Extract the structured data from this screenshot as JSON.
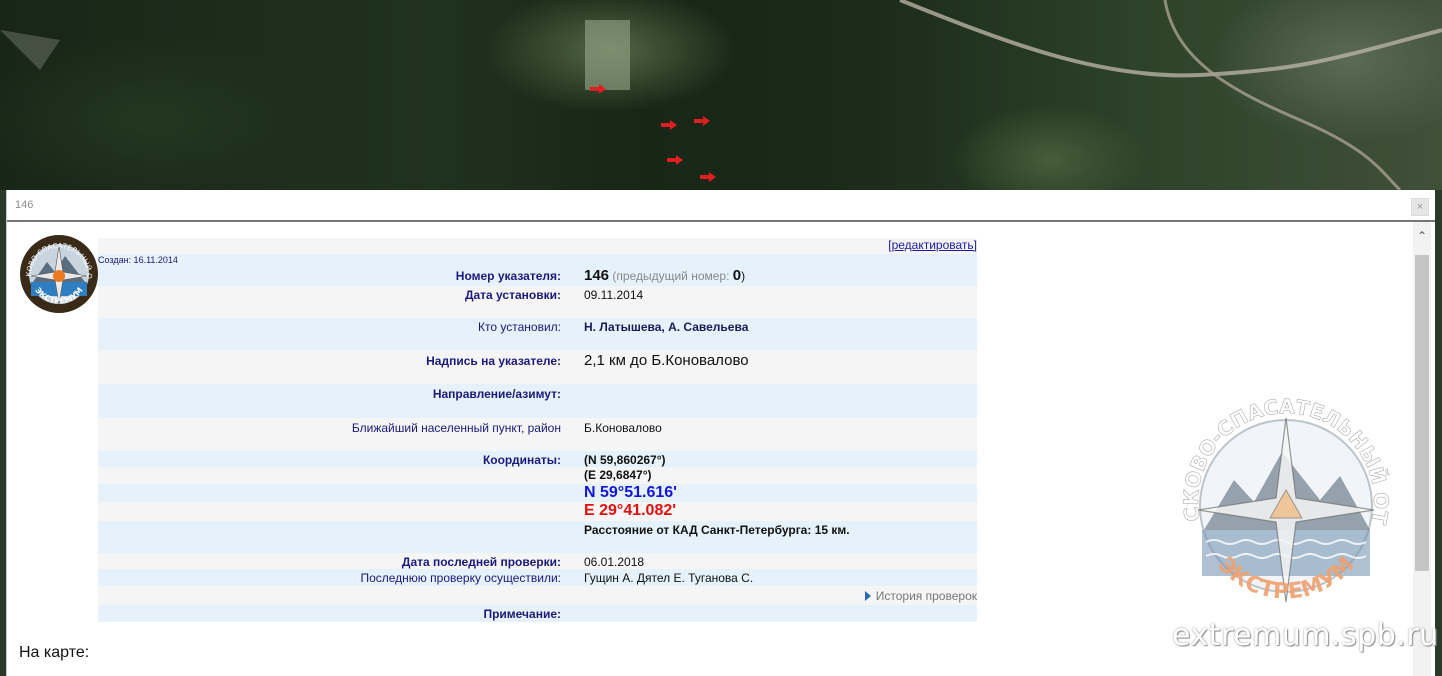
{
  "dialog": {
    "title": "146",
    "close_label": "×"
  },
  "card": {
    "edit_link": "[редактировать]",
    "created": "Создан: 16.11.2014",
    "pointer_number_label": "Номер указателя:",
    "pointer_number": "146",
    "prev_number_label": "(предыдущий номер: ",
    "prev_number": "0",
    "prev_number_close": ")",
    "install_date_label": "Дата установки:",
    "install_date": "09.11.2014",
    "installed_by_label": "Кто установил:",
    "installed_by": "Н. Латышева, А. Савельева",
    "inscription_label": "Надпись на указателе:",
    "inscription": "2,1 км до Б.Коновалово",
    "direction_label": "Направление/азимут:",
    "direction": "",
    "nearest_label": "Ближайший населенный пункт, район",
    "nearest": "Б.Коновалово",
    "coords_label": "Координаты:",
    "coord_n_dec": "(N 59,860267°)",
    "coord_e_dec": "(E 29,6847°)",
    "coord_n": "N 59°51.616'",
    "coord_e": "E 29°41.082'",
    "distance": "Расстояние от КАД Санкт-Петербурга: 15 км.",
    "last_check_label": "Дата последней проверки:",
    "last_check": "06.01.2018",
    "checked_by_label": "Последнюю проверку осуществили:",
    "checked_by": "Гущин А. Дятел Е. Туганова С.",
    "history_link": "История проверок",
    "note_label": "Примечание:",
    "note": ""
  },
  "on_map": "На карте:",
  "watermark": {
    "ring_text": "ПОИСКОВО-СПАСАТЕЛЬНЫЙ ОТРЯД",
    "name": "ЭКСТРЕМУМ",
    "site": "extremum.spb.ru"
  },
  "logo_small": {
    "ring_text": "ПОИСКОВО-СПАСАТЕЛЬНЫЙ ОТРЯД",
    "name": "ЭКСТРЕМУМ"
  },
  "colors": {
    "row_blue": "#e6f2fb",
    "row_gray": "#f5f5f5",
    "label_navy": "#1a1a7a",
    "coord_n": "#1515d6",
    "coord_e": "#e01010",
    "map_marker": "#e02020"
  }
}
